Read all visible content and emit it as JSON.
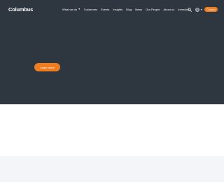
{
  "brand": {
    "logo_text": "Columbus"
  },
  "nav": {
    "items": [
      {
        "label": "What we do",
        "has_dropdown": true
      },
      {
        "label": "Customers"
      },
      {
        "label": "Events"
      },
      {
        "label": "Insights"
      },
      {
        "label": "Blog"
      },
      {
        "label": "News"
      },
      {
        "label": "Our People"
      },
      {
        "label": "About us"
      },
      {
        "label": "Investors"
      }
    ],
    "icons": {
      "search": "search-icon",
      "language": "globe-icon"
    },
    "contact_label": "Contact"
  },
  "hero": {
    "cta_label": "Learn more"
  },
  "colors": {
    "hero_bg": "#2e3740",
    "accent": "#ee7d22",
    "footer_band": "#f4f5f8"
  }
}
